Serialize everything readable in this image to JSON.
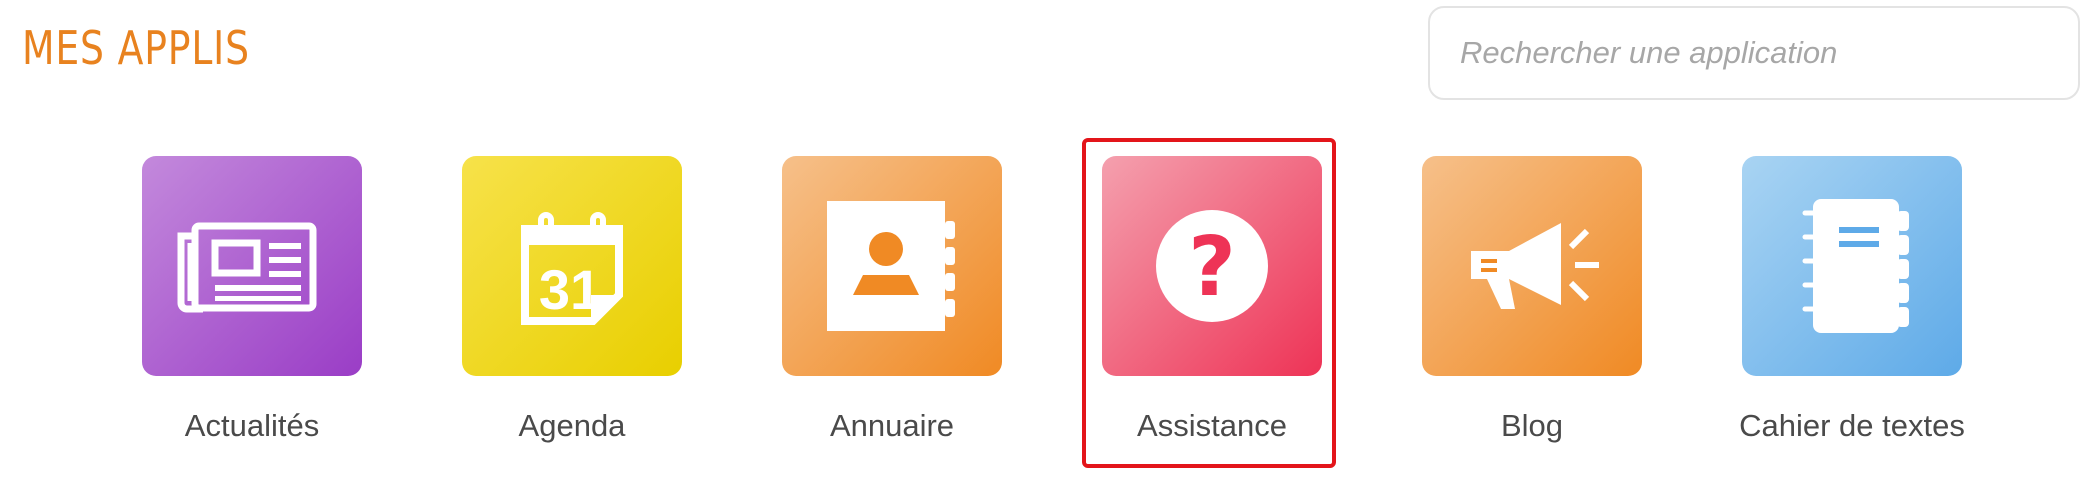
{
  "header": {
    "title": "MES APPLIS"
  },
  "search": {
    "placeholder": "Rechercher une application",
    "value": ""
  },
  "apps": [
    {
      "label": "Actualités",
      "icon": "newspaper-icon",
      "color_start": "#c389dc",
      "color_end": "#9a3dc6"
    },
    {
      "label": "Agenda",
      "icon": "calendar-icon",
      "calendar_day": "31",
      "color_start": "#f7e24a",
      "color_end": "#e8cf00"
    },
    {
      "label": "Annuaire",
      "icon": "address-book-icon",
      "color_start": "#f6c08a",
      "color_end": "#f08a24"
    },
    {
      "label": "Assistance",
      "icon": "question-icon",
      "question_glyph": "?",
      "color_start": "#f4a0ae",
      "color_end": "#ee3356",
      "selected": true
    },
    {
      "label": "Blog",
      "icon": "megaphone-icon",
      "color_start": "#f6c08a",
      "color_end": "#f08a24"
    },
    {
      "label": "Cahier de textes",
      "icon": "notebook-icon",
      "color_start": "#a9d4f3",
      "color_end": "#5eaae8"
    }
  ],
  "colors": {
    "title": "#e8821f",
    "selection_border": "#e3151a",
    "label_text": "#4a4a4a"
  }
}
